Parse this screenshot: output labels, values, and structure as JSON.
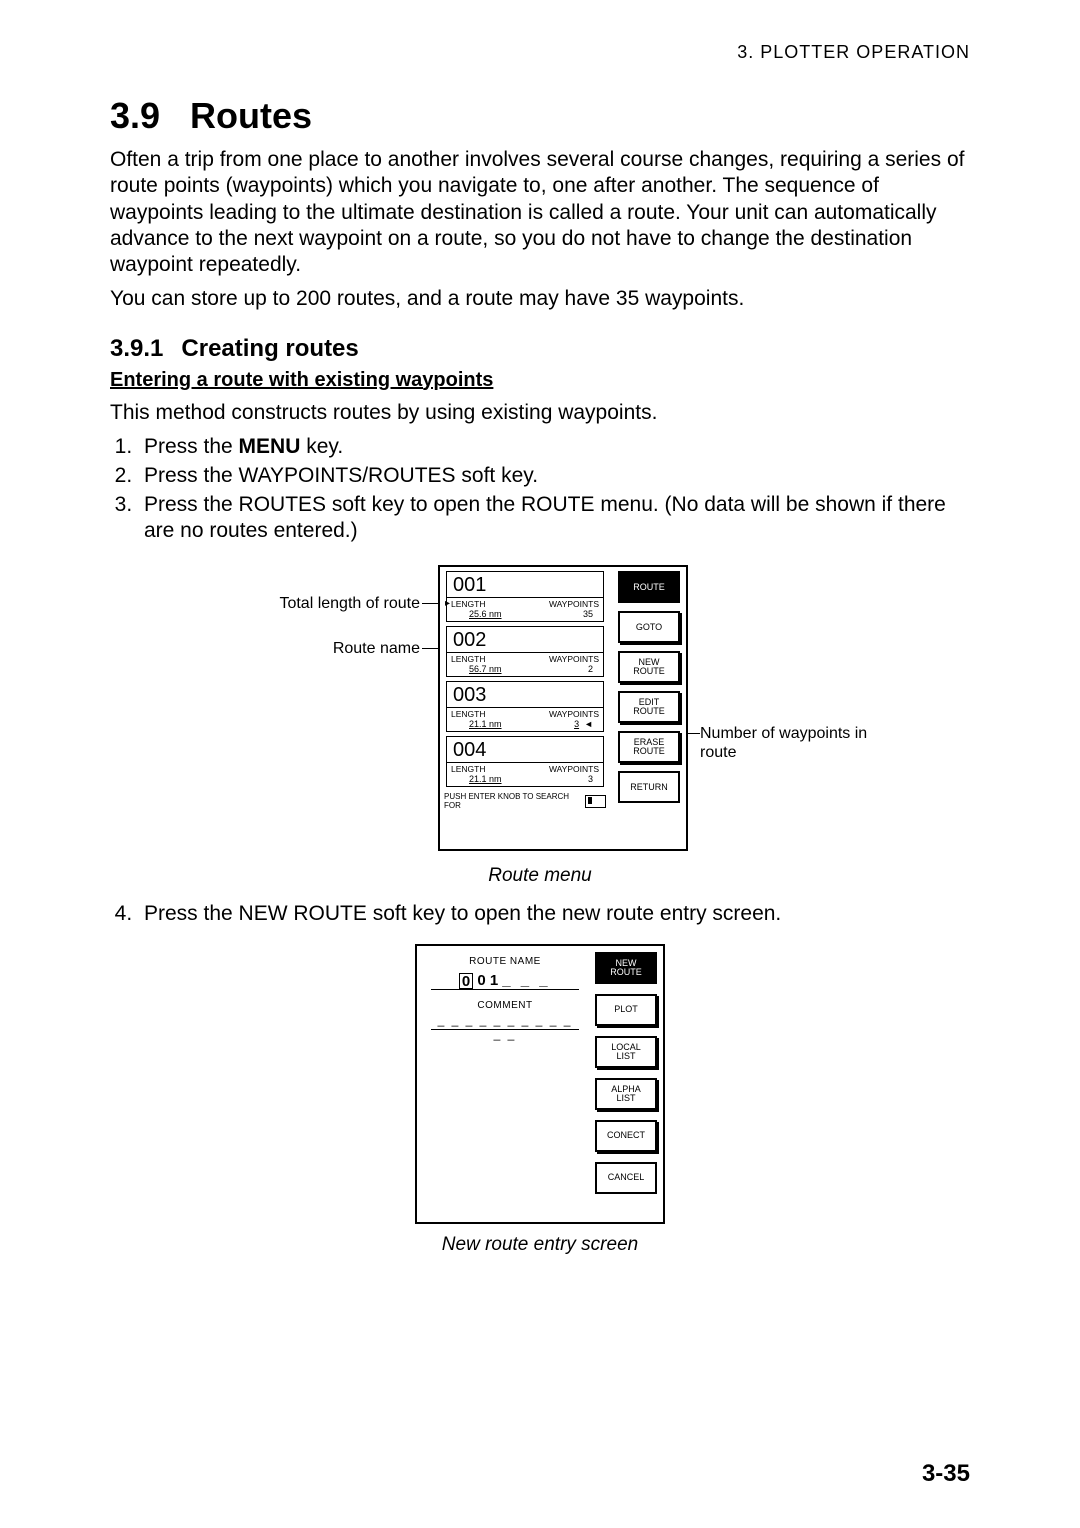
{
  "header": {
    "chapterRef": "3.  PLOTTER  OPERATION"
  },
  "section": {
    "number": "3.9",
    "title": "Routes",
    "para1": "Often a trip from one place to another involves several course changes, requiring a series of route points (waypoints) which you navigate to, one after another. The sequence of waypoints leading to the ultimate destination is called a route. Your unit can automatically advance to the next waypoint on a route, so you do not have to change the destination waypoint repeatedly.",
    "para2": "You can store up to 200 routes, and a route may have 35 waypoints."
  },
  "subsection": {
    "number": "3.9.1",
    "title": "Creating routes",
    "subhead": "Entering a route with existing waypoints",
    "intro": "This method constructs routes by using existing waypoints.",
    "steps": [
      {
        "pre": "Press the ",
        "bold": "MENU",
        "post": " key."
      },
      {
        "text": "Press the WAYPOINTS/ROUTES soft key."
      },
      {
        "text": "Press the ROUTES soft key to open the ROUTE menu. (No data will be shown if there are no routes entered.)"
      },
      {
        "text": "Press the NEW ROUTE soft key to open the new route entry screen."
      }
    ]
  },
  "figure1": {
    "callouts": {
      "totalLength": "Total length of route",
      "routeName": "Route name",
      "numWaypoints": "Number of waypoints in route"
    },
    "routes": [
      {
        "name": "001",
        "lengthLabel": "LENGTH",
        "length": "25.6 nm",
        "wpLabel": "WAYPOINTS",
        "wp": "35"
      },
      {
        "name": "002",
        "lengthLabel": "LENGTH",
        "length": "56.7 nm",
        "wpLabel": "WAYPOINTS",
        "wp": "2"
      },
      {
        "name": "003",
        "lengthLabel": "LENGTH",
        "length": "21.1 nm",
        "wpLabel": "WAYPOINTS",
        "wp": "3"
      },
      {
        "name": "004",
        "lengthLabel": "LENGTH",
        "length": "21.1 nm",
        "wpLabel": "WAYPOINTS",
        "wp": "3"
      }
    ],
    "hint": "PUSH ENTER KNOB TO SEARCH FOR",
    "softkeys": {
      "header": "ROUTE",
      "k1": "GOTO",
      "k2a": "NEW",
      "k2b": "ROUTE",
      "k3a": "EDIT",
      "k3b": "ROUTE",
      "k4a": "ERASE",
      "k4b": "ROUTE",
      "k5": "RETURN"
    },
    "caption": "Route menu"
  },
  "figure2": {
    "routeNameLabel": "ROUTE NAME",
    "routeNameRest": "0 1",
    "routeNameBlanks": "_ _ _",
    "commentLabel": "COMMENT",
    "commentBlanks": "_ _ _ _ _ _ _ _ _ _ _ _",
    "softkeys": {
      "header1": "NEW",
      "header2": "ROUTE",
      "k1": "PLOT",
      "k2a": "LOCAL",
      "k2b": "LIST",
      "k3a": "ALPHA",
      "k3b": "LIST",
      "k4": "CONECT",
      "k5": "CANCEL"
    },
    "caption": "New route entry screen"
  },
  "footer": {
    "pageNumber": "3-35"
  }
}
